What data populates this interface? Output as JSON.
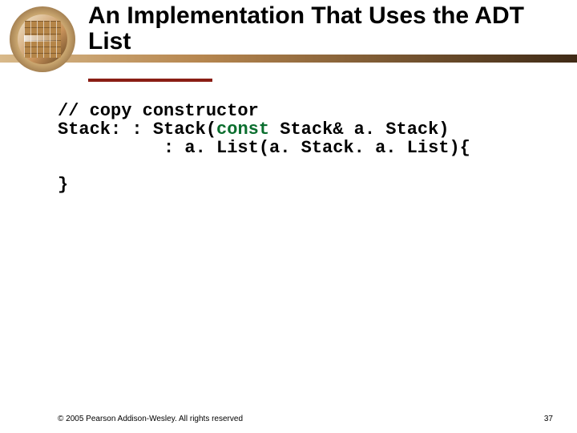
{
  "title": "An Implementation That Uses the ADT List",
  "code": {
    "l1a": "// copy constructor",
    "l2a": "Stack: : Stack(",
    "l2kw": "const",
    "l2b": " Stack& a. Stack)",
    "l3a": "          : a. List(a. Stack. a. List){",
    "l4a": " ",
    "l5a": "}"
  },
  "footer": {
    "copyright": "© 2005 Pearson Addison-Wesley. All rights reserved",
    "page": "37"
  }
}
